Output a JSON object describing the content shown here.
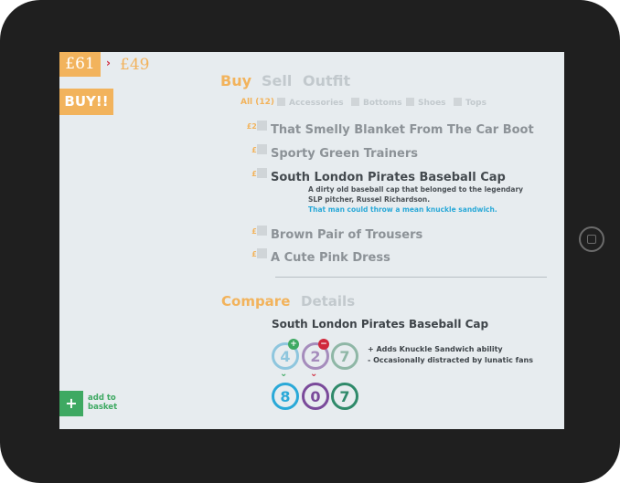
{
  "pricing": {
    "old": "£61",
    "arrow": "›",
    "new": "£49",
    "buy_label": "BUY!!"
  },
  "tabs": [
    {
      "label": "Buy",
      "active": true
    },
    {
      "label": "Sell",
      "active": false
    },
    {
      "label": "Outfit",
      "active": false
    }
  ],
  "filters": {
    "all": "All (12)",
    "categories": [
      "Accessories",
      "Bottoms",
      "Shoes",
      "Tops"
    ]
  },
  "items": [
    {
      "price": "£214",
      "name": "That Smelly Blanket From The Car Boot"
    },
    {
      "price": "£22",
      "name": "Sporty Green Trainers"
    },
    {
      "price": "£12",
      "name": "South London Pirates Baseball Cap",
      "selected": true
    },
    {
      "price": "£15",
      "name": "Brown Pair of Trousers"
    },
    {
      "price": "£11",
      "name": "A Cute Pink Dress"
    }
  ],
  "selected_description": {
    "line1": "A dirty old baseball cap that belonged to the legendary",
    "line2": "SLP pitcher, Russel Richardson.",
    "line3": "That man could throw a mean knuckle sandwich."
  },
  "compare_tabs": [
    {
      "label": "Compare",
      "active": true
    },
    {
      "label": "Details",
      "active": false
    }
  ],
  "compare": {
    "title": "South London Pirates Baseball Cap",
    "current": [
      {
        "value": "4",
        "badge": "+",
        "color": "#2aa9d8",
        "muted_color": "#8ec6de"
      },
      {
        "value": "2",
        "badge": "−",
        "color": "#7a4a9a",
        "muted_color": "#a58cbc"
      },
      {
        "value": "7",
        "badge": "",
        "color": "#2f8a6a",
        "muted_color": "#8fb7a6"
      }
    ],
    "new": [
      {
        "value": "8",
        "color": "#2aa9d8"
      },
      {
        "value": "0",
        "color": "#7a4a9a"
      },
      {
        "value": "7",
        "color": "#2f8a6a"
      }
    ],
    "badge_colors": {
      "plus": "#3ea962",
      "minus": "#d0283b"
    },
    "effects": [
      "+ Adds Knuckle Sandwich ability",
      "- Occasionally distracted by lunatic fans"
    ]
  },
  "basket": {
    "icon": "+",
    "label_line1": "add to",
    "label_line2": "basket"
  }
}
